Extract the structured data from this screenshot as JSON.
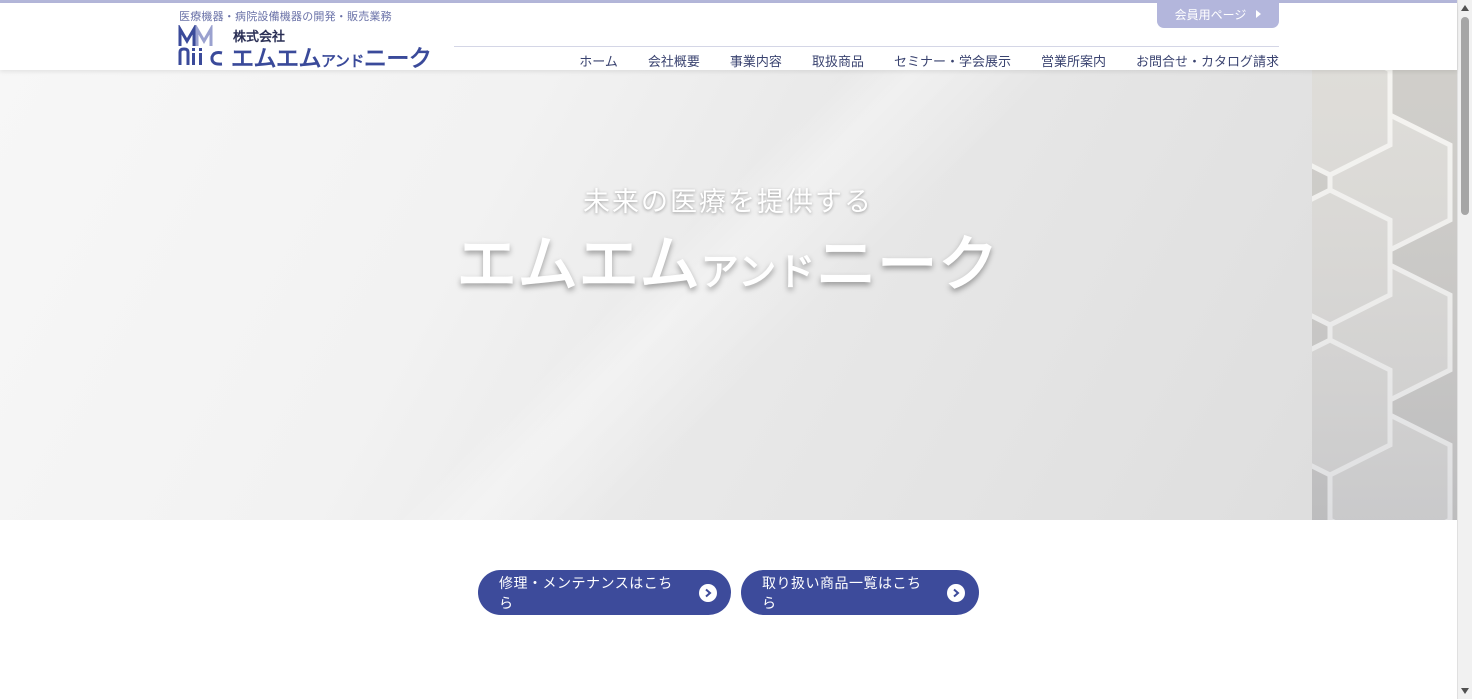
{
  "header": {
    "tagline": "医療機器・病院設備機器の開発・販売業務",
    "logo_company_type": "株式会社",
    "logo_name_main": "エムエム",
    "logo_name_small": "アンド",
    "logo_name_tail": "ニーク",
    "member_button": "会員用ページ"
  },
  "nav": {
    "items": [
      "ホーム",
      "会社概要",
      "事業内容",
      "取扱商品",
      "セミナー・学会展示",
      "営業所案内",
      "お問合せ・カタログ請求"
    ]
  },
  "hero": {
    "subtitle": "未来の医療を提供する",
    "title_main": "エムエム",
    "title_small": "アンド",
    "title_tail": "ニーク"
  },
  "buttons": {
    "repair": "修理・メンテナンスはこちら",
    "products": "取り扱い商品一覧はこちら"
  },
  "colors": {
    "brand": "#3d4b9b",
    "member": "#b3b6dc",
    "nav_text": "#3a4370"
  }
}
